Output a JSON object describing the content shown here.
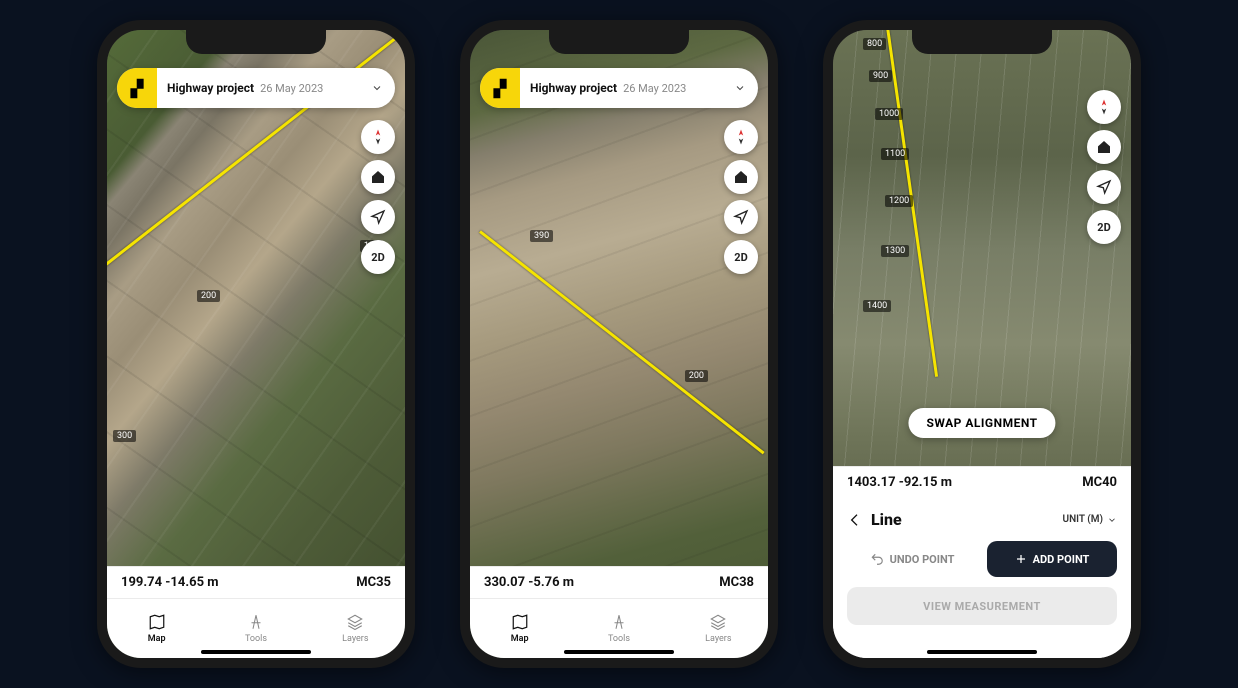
{
  "project": {
    "name": "Highway project",
    "date": "26 May 2023",
    "logo_glyph": "▞"
  },
  "map_buttons": {
    "compass": "compass-icon",
    "home": "home-icon",
    "location": "navigate-icon",
    "mode2d": "2D"
  },
  "nav": {
    "map": "Map",
    "tools": "Tools",
    "layers": "Layers"
  },
  "phone1": {
    "coord": "199.74 -14.65 m",
    "chainage_id": "MC35",
    "ticks": [
      "100",
      "200",
      "300"
    ]
  },
  "phone2": {
    "coord": "330.07 -5.76 m",
    "chainage_id": "MC38",
    "ticks": [
      "200",
      "390"
    ]
  },
  "phone3": {
    "coord": "1403.17 -92.15 m",
    "chainage_id": "MC40",
    "swap_label": "SWAP ALIGNMENT",
    "ticks": [
      "800",
      "900",
      "1000",
      "1100",
      "1200",
      "1300",
      "1400"
    ],
    "panel": {
      "title": "Line",
      "unit_label": "UNIT (M)",
      "undo": "UNDO POINT",
      "add": "ADD POINT",
      "view": "VIEW MEASUREMENT"
    }
  }
}
